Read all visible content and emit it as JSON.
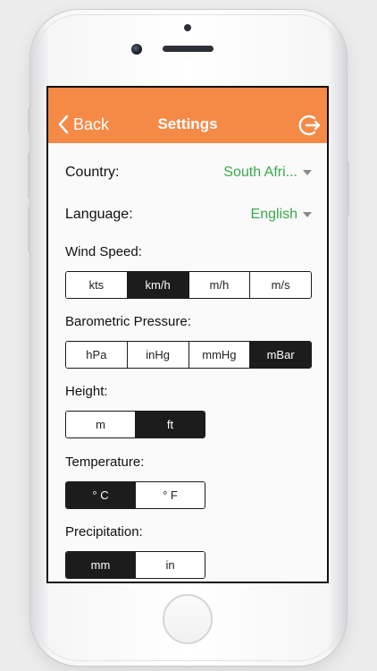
{
  "nav": {
    "back_label": "Back",
    "title": "Settings"
  },
  "country": {
    "label": "Country:",
    "value": "South Afri..."
  },
  "language": {
    "label": "Language:",
    "value": "English"
  },
  "wind_speed": {
    "label": "Wind Speed:",
    "options": [
      "kts",
      "km/h",
      "m/h",
      "m/s"
    ],
    "selected": "km/h"
  },
  "pressure": {
    "label": "Barometric Pressure:",
    "options": [
      "hPa",
      "inHg",
      "mmHg",
      "mBar"
    ],
    "selected": "mBar"
  },
  "height": {
    "label": "Height:",
    "options": [
      "m",
      "ft"
    ],
    "selected": "ft"
  },
  "temperature": {
    "label": "Temperature:",
    "options": [
      "° C",
      "° F"
    ],
    "selected": "° C"
  },
  "precipitation": {
    "label": "Precipitation:",
    "options": [
      "mm",
      "in"
    ],
    "selected": "mm"
  },
  "colors": {
    "accent": "#f58a47",
    "value_green": "#3aa84a",
    "selected_segment": "#1c1c1c"
  },
  "icons": {
    "back": "chevron-left-icon",
    "logout": "logout-icon",
    "dropdown": "caret-down-icon"
  }
}
